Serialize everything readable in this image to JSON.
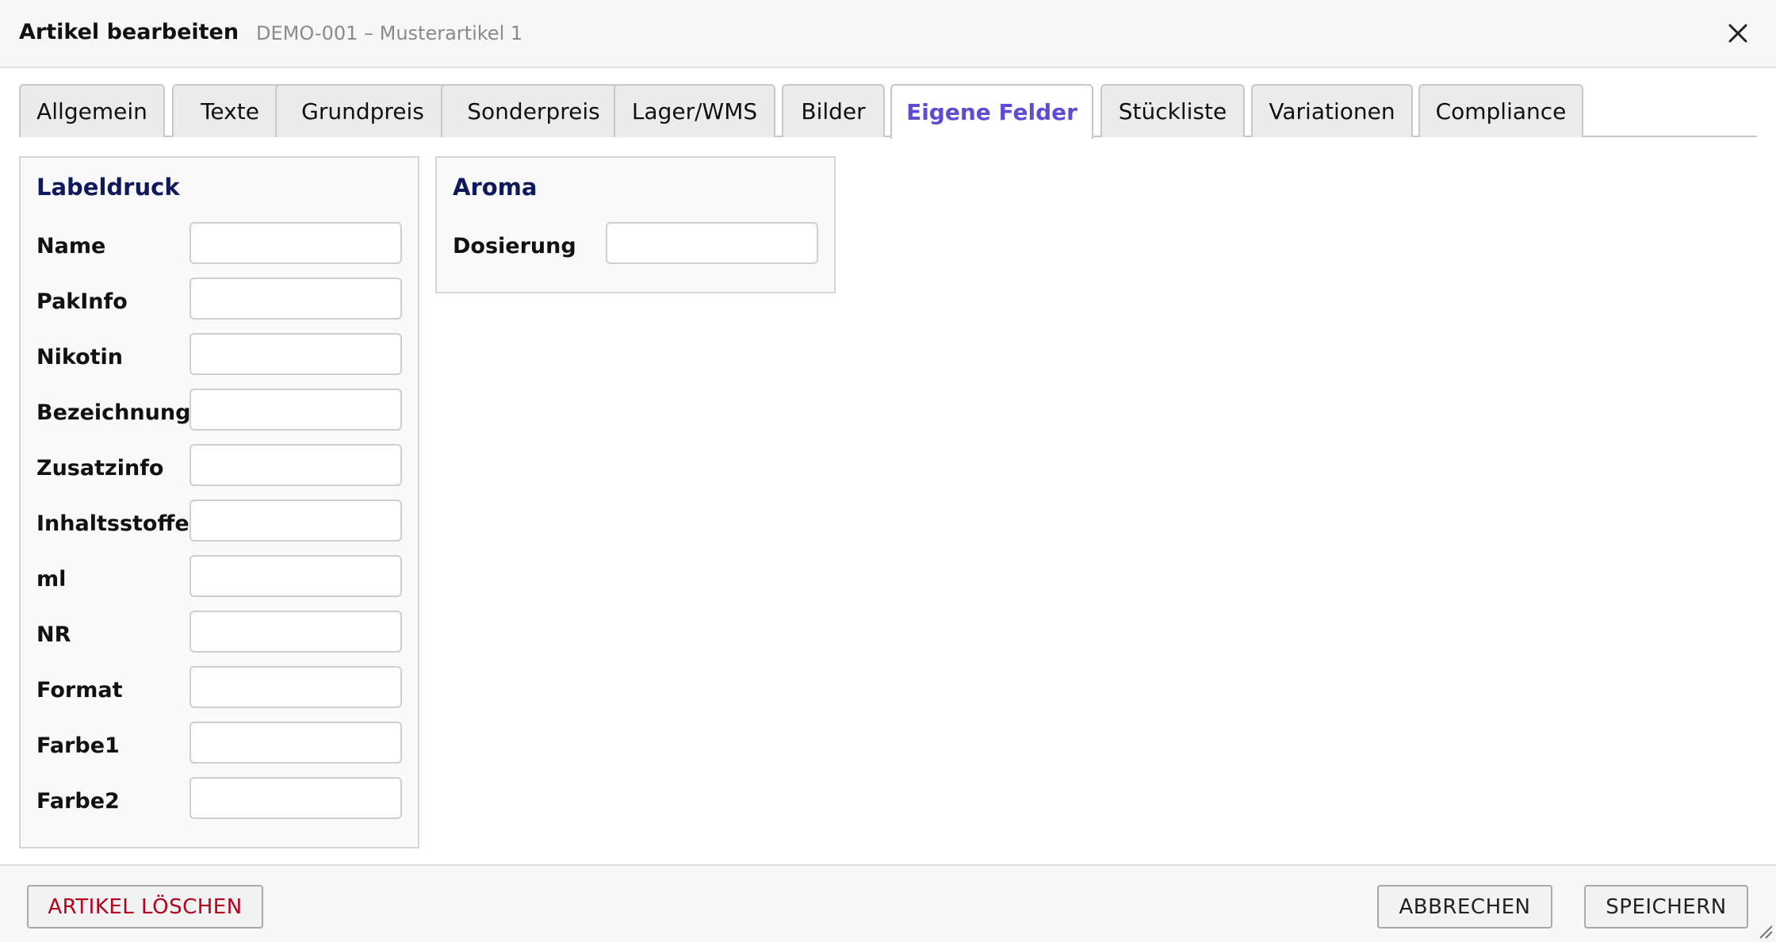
{
  "dialog": {
    "title": "Artikel bearbeiten",
    "subtitle": "DEMO-001 – Musterartikel 1"
  },
  "tabs": [
    {
      "label": "Allgemein",
      "active": false
    },
    {
      "label": "Texte",
      "active": false
    },
    {
      "label": "Grundpreis",
      "active": false
    },
    {
      "label": "Sonderpreis",
      "active": false
    },
    {
      "label": "Lager/WMS",
      "active": false
    },
    {
      "label": "Bilder",
      "active": false
    },
    {
      "label": "Eigene Felder",
      "active": true
    },
    {
      "label": "Stückliste",
      "active": false
    },
    {
      "label": "Variationen",
      "active": false
    },
    {
      "label": "Compliance",
      "active": false
    }
  ],
  "labeldruck": {
    "legend": "Labeldruck",
    "fields": [
      {
        "label": "Name",
        "value": ""
      },
      {
        "label": "PakInfo",
        "value": ""
      },
      {
        "label": "Nikotin",
        "value": ""
      },
      {
        "label": "Bezeichnung",
        "value": ""
      },
      {
        "label": "Zusatzinfo",
        "value": ""
      },
      {
        "label": "Inhaltsstoffe",
        "value": ""
      },
      {
        "label": "ml",
        "value": ""
      },
      {
        "label": "NR",
        "value": ""
      },
      {
        "label": "Format",
        "value": ""
      },
      {
        "label": "Farbe1",
        "value": ""
      },
      {
        "label": "Farbe2",
        "value": ""
      }
    ]
  },
  "aroma": {
    "legend": "Aroma",
    "fields": [
      {
        "label": "Dosierung",
        "value": ""
      }
    ]
  },
  "footer": {
    "delete_label": "ARTIKEL LÖSCHEN",
    "cancel_label": "ABBRECHEN",
    "save_label": "SPEICHERN"
  },
  "colors": {
    "accent": "#5e4bd6",
    "legend": "#0e1a5c",
    "danger": "#b3001b"
  },
  "icons": {
    "close": "close-icon",
    "resize": "resize-grip-icon"
  }
}
